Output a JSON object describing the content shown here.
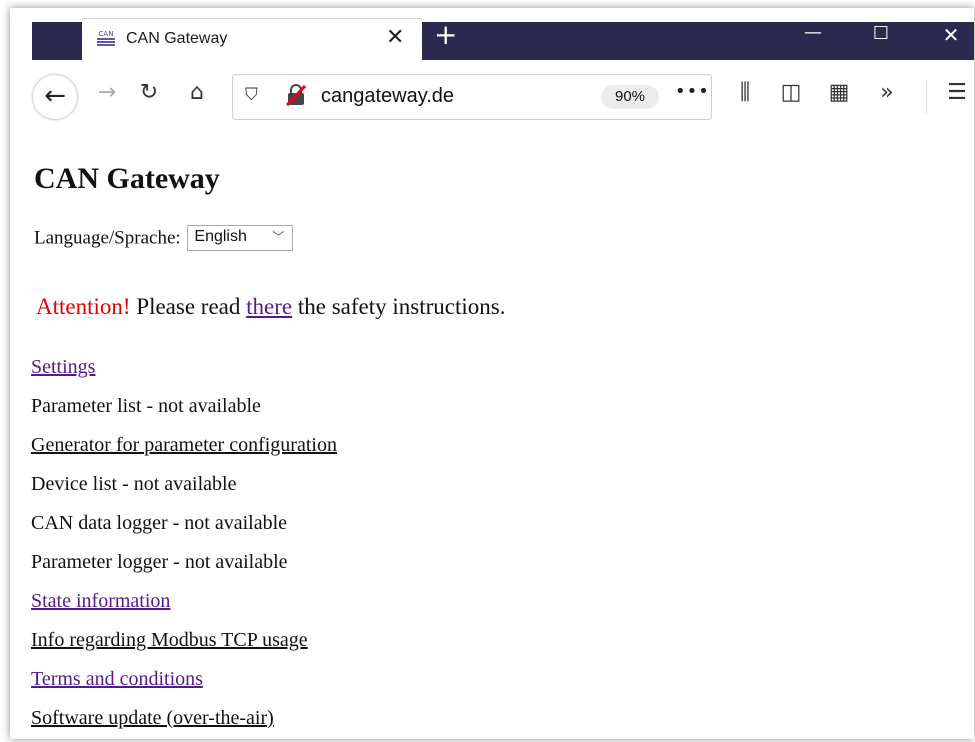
{
  "browser": {
    "tab_title": "CAN Gateway",
    "favicon_text": "CAN",
    "url": "cangateway.de",
    "zoom": "90%",
    "more": "•••",
    "colors": {
      "tabstrip": "#2b2a4e"
    }
  },
  "page": {
    "title": "CAN Gateway",
    "language_label": "Language/Sprache:",
    "language_selected": "English",
    "attention_prefix": "Attention!",
    "attention_mid": "Please read",
    "attention_link": "there",
    "attention_suffix": "the safety instructions.",
    "menu": [
      {
        "label": "Settings",
        "link": true,
        "visited": true
      },
      {
        "label": "Parameter list - not available",
        "link": false
      },
      {
        "label": "Generator for parameter configuration",
        "link": true,
        "visited": false
      },
      {
        "label": "Device list - not available",
        "link": false
      },
      {
        "label": "CAN data logger - not available",
        "link": false
      },
      {
        "label": "Parameter logger - not available",
        "link": false
      },
      {
        "label": "State information",
        "link": true,
        "visited": true
      },
      {
        "label": "Info regarding Modbus TCP usage",
        "link": true,
        "visited": false
      },
      {
        "label": "Terms and conditions",
        "link": true,
        "visited": true
      },
      {
        "label": "Software update (over-the-air)",
        "link": true,
        "visited": false
      }
    ],
    "colors": {
      "warning": "#e00000",
      "link": "#0000ee",
      "visited": "#551a8b"
    }
  }
}
